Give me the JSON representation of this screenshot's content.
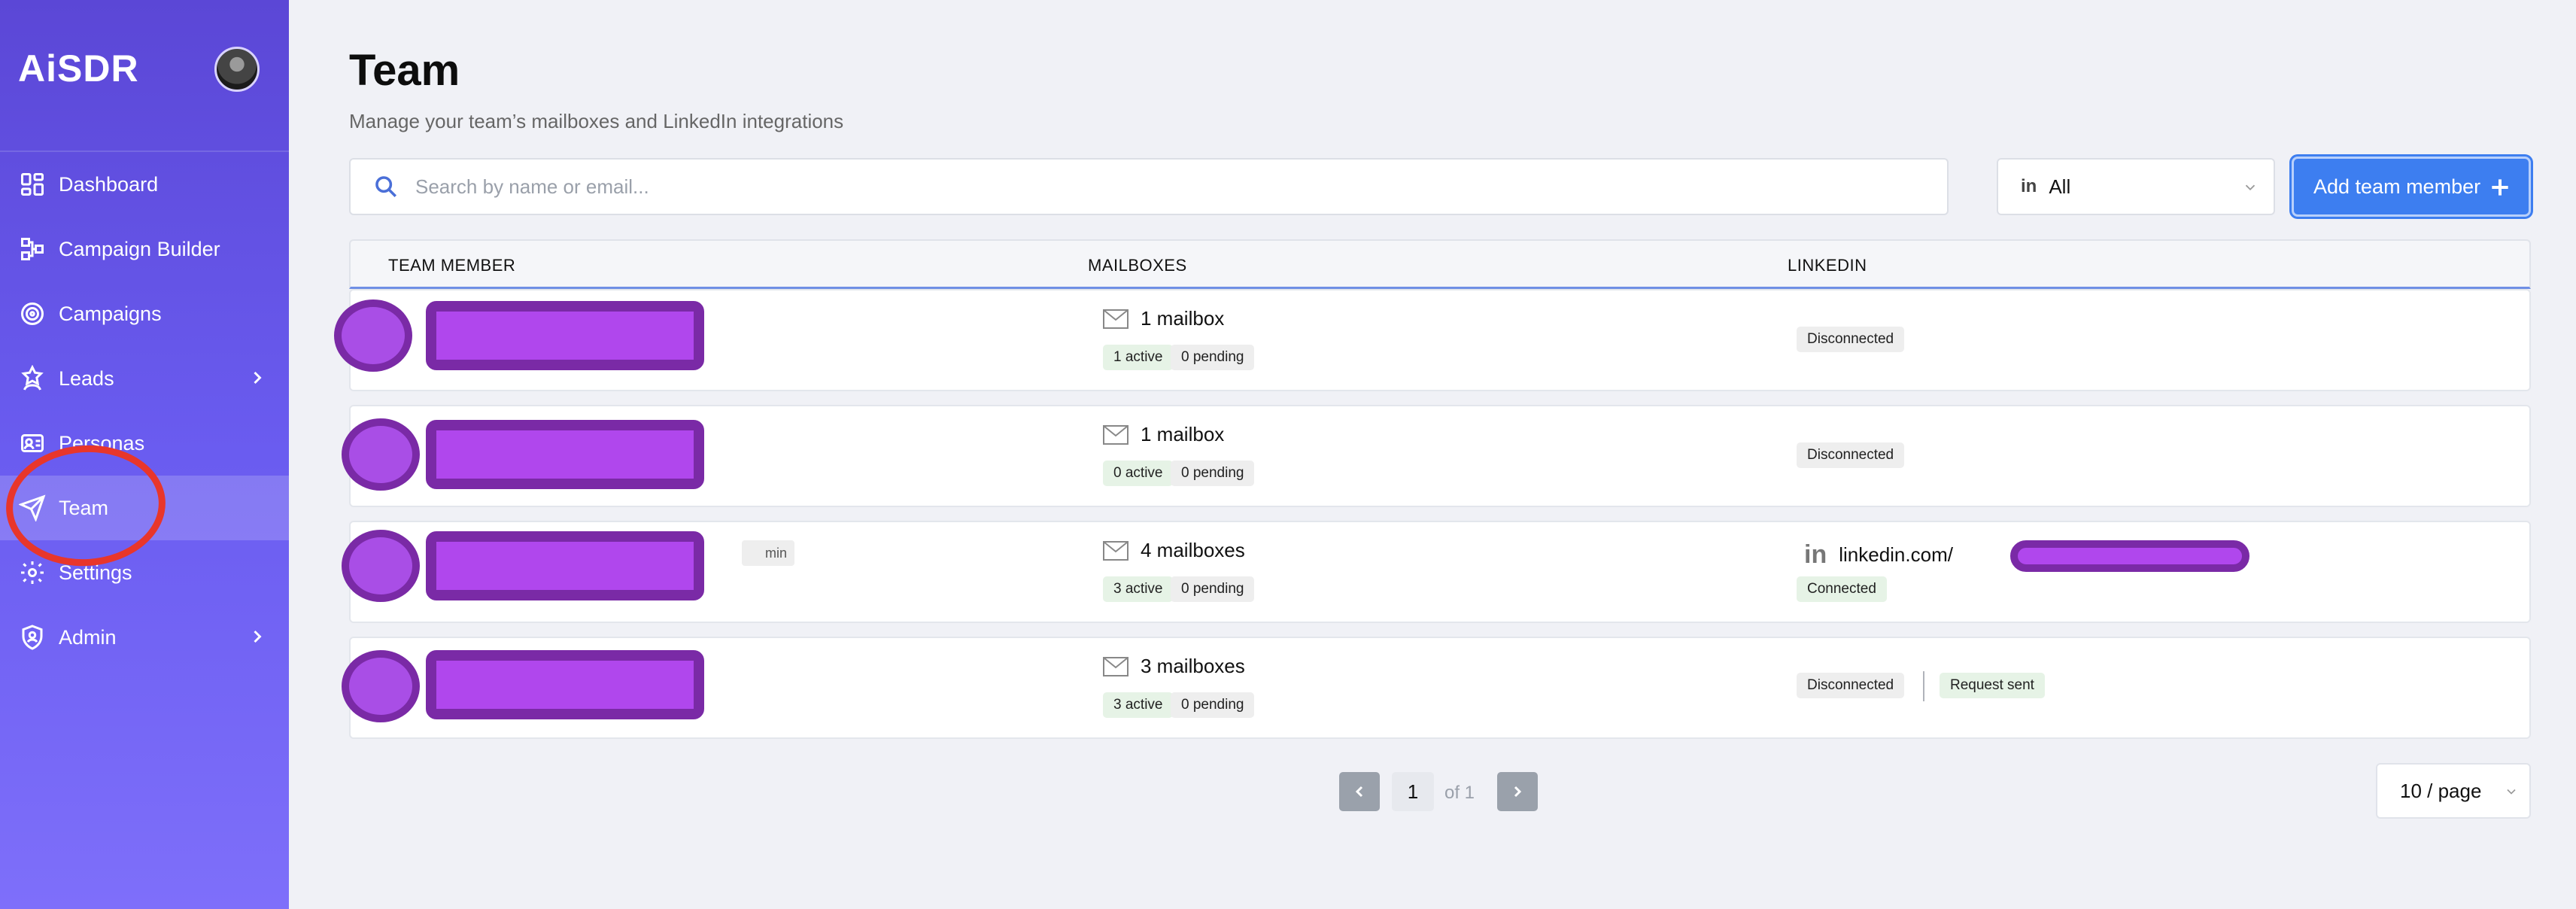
{
  "app": {
    "brand": "AiSDR"
  },
  "sidebar": {
    "items": [
      {
        "label": "Dashboard",
        "icon": "dashboard-icon",
        "active": false,
        "has_chevron": false
      },
      {
        "label": "Campaign Builder",
        "icon": "campaign-builder-icon",
        "active": false,
        "has_chevron": false
      },
      {
        "label": "Campaigns",
        "icon": "target-icon",
        "active": false,
        "has_chevron": false
      },
      {
        "label": "Leads",
        "icon": "star-person-icon",
        "active": false,
        "has_chevron": true
      },
      {
        "label": "Personas",
        "icon": "persona-icon",
        "active": false,
        "has_chevron": false
      },
      {
        "label": "Team",
        "icon": "paper-plane-icon",
        "active": true,
        "has_chevron": false
      },
      {
        "label": "Settings",
        "icon": "gear-icon",
        "active": false,
        "has_chevron": false
      },
      {
        "label": "Admin",
        "icon": "shield-user-icon",
        "active": false,
        "has_chevron": true
      }
    ],
    "annotation_color": "#e8362b"
  },
  "page": {
    "title": "Team",
    "subtitle": "Manage your team’s mailboxes and LinkedIn integrations"
  },
  "search": {
    "placeholder": "Search by name or email..."
  },
  "filter": {
    "icon_text": "in",
    "value": "All"
  },
  "add_button": {
    "label": "Add team member"
  },
  "table": {
    "headers": {
      "member": "TEAM MEMBER",
      "mailboxes": "MAILBOXES",
      "linkedin": "LINKEDIN"
    },
    "rows": [
      {
        "mailboxes": "1 mailbox",
        "active": "1 active",
        "pending": "0 pending",
        "linkedin_status": "Disconnected"
      },
      {
        "mailboxes": "1 mailbox",
        "active": "0 active",
        "pending": "0 pending",
        "linkedin_status": "Disconnected"
      },
      {
        "admin_badge": "min",
        "mailboxes": "4 mailboxes",
        "active": "3 active",
        "pending": "0 pending",
        "linkedin_url": "linkedin.com/",
        "linkedin_status": "Connected"
      },
      {
        "mailboxes": "3 mailboxes",
        "active": "3 active",
        "pending": "0 pending",
        "linkedin_status": "Disconnected",
        "request": "Request sent"
      }
    ]
  },
  "pagination": {
    "current": "1",
    "of": "of 1",
    "per_page": "10 / page"
  },
  "colors": {
    "accent": "#3d7ef0",
    "redaction": "#b047ed",
    "redaction_border": "#7a2aa6"
  }
}
